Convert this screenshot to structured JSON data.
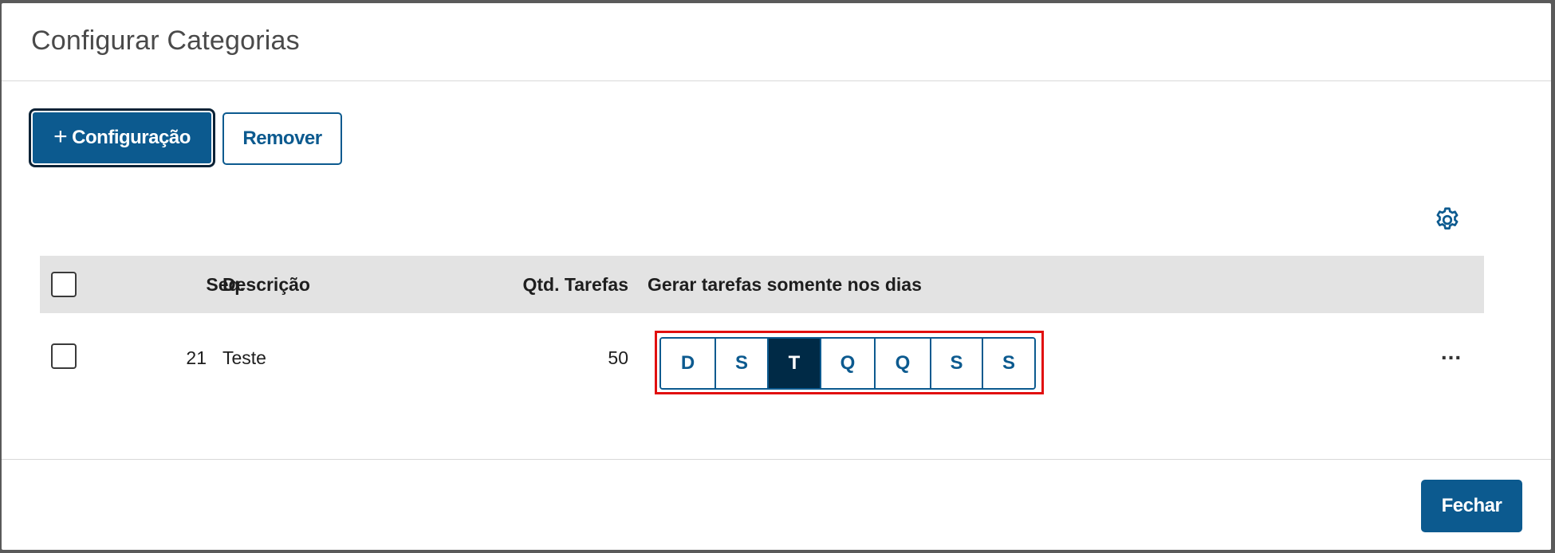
{
  "modal": {
    "title": "Configurar Categorias"
  },
  "toolbar": {
    "add_icon": "+",
    "add_label": "Configuração",
    "remove_label": "Remover"
  },
  "table": {
    "settings_icon": "gear-icon",
    "columns": {
      "seq": "Seq.",
      "descricao": "Descrição",
      "qtd_tarefas": "Qtd. Tarefas",
      "gerar_dias": "Gerar tarefas somente nos dias"
    },
    "rows": [
      {
        "seq": "21",
        "descricao": "Teste",
        "qtd_tarefas": "50",
        "days": [
          {
            "label": "D",
            "selected": false
          },
          {
            "label": "S",
            "selected": false
          },
          {
            "label": "T",
            "selected": true
          },
          {
            "label": "Q",
            "selected": false
          },
          {
            "label": "Q",
            "selected": false
          },
          {
            "label": "S",
            "selected": false
          },
          {
            "label": "S",
            "selected": false
          }
        ],
        "more_actions": "..."
      }
    ]
  },
  "footer": {
    "close_label": "Fechar"
  },
  "colors": {
    "primary": "#0c5a8f",
    "selected_day": "#002a46",
    "highlight": "#e10f0f",
    "header_bg": "#e3e3e3"
  }
}
